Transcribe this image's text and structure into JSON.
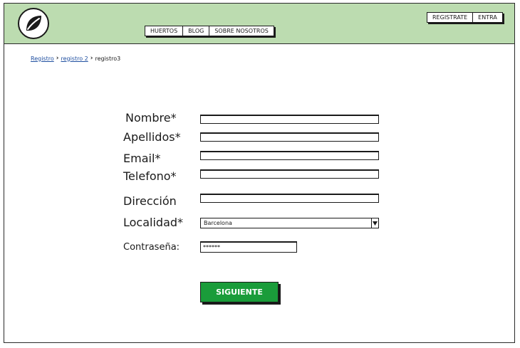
{
  "header": {
    "logo_icon": "leaf-icon",
    "background": "#bcdcb0",
    "nav": [
      "HUERTOS",
      "BLOG",
      "SOBRE NOSOTROS"
    ],
    "auth": [
      "REGISTRATE",
      "ENTRA"
    ]
  },
  "breadcrumb": {
    "items": [
      "Registro",
      "registro 2",
      "registro3"
    ],
    "separator": "›"
  },
  "form": {
    "fields": {
      "nombre": {
        "label": "Nombre*",
        "value": ""
      },
      "apellidos": {
        "label": "Apellidos*",
        "value": ""
      },
      "email": {
        "label": "Email*",
        "value": ""
      },
      "telefono": {
        "label": "Telefono*",
        "value": ""
      },
      "direccion": {
        "label": "Dirección",
        "value": ""
      },
      "localidad": {
        "label": "Localidad*",
        "value": "Barcelona"
      },
      "contrasena": {
        "label": "Contraseña:",
        "value": "******"
      }
    },
    "submit_label": "SIGUIENTE",
    "submit_color": "#1a9c3a"
  }
}
